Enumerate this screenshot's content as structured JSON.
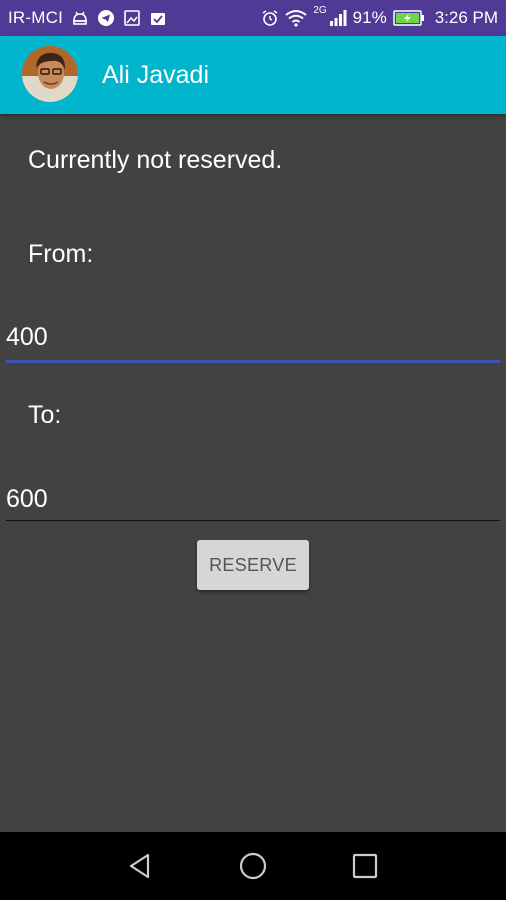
{
  "status_bar": {
    "carrier": "IR-MCI",
    "network": "2G",
    "battery_percent": "91%",
    "time": "3:26 PM",
    "bg_color": "#4f3a96",
    "icons_left": [
      "android-debug-icon",
      "telegram-icon",
      "gallery-icon",
      "clipboard-check-icon"
    ],
    "icons_right": [
      "alarm-icon",
      "wifi-icon",
      "signal-icon",
      "battery-charging-icon"
    ]
  },
  "app_bar": {
    "title": "Ali Javadi",
    "bg_color": "#00b5cc",
    "avatar": "profile-avatar"
  },
  "content": {
    "status_text": "Currently not reserved.",
    "from_label": "From:",
    "from_value": "400",
    "to_label": "To:",
    "to_value": "600",
    "reserve_button": "RESERVE",
    "focus_color": "#3f51b5"
  },
  "nav_bar": {
    "buttons": [
      "back-icon",
      "home-icon",
      "recents-icon"
    ]
  }
}
